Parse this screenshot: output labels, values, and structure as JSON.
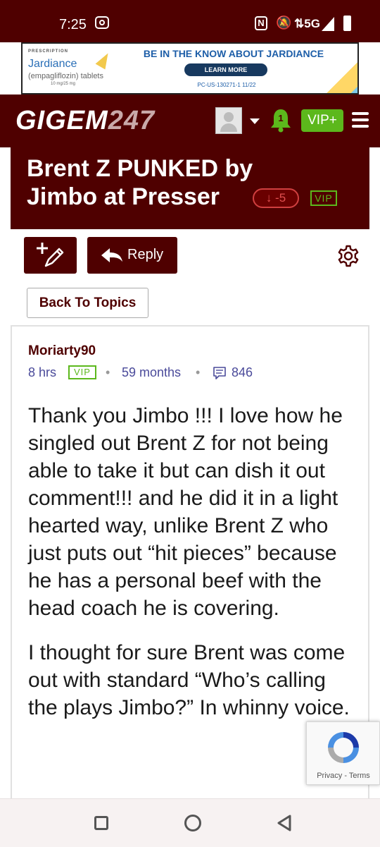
{
  "status_bar": {
    "time": "7:25",
    "network": "5G",
    "nfc": "N"
  },
  "ad": {
    "rx_label": "PRESCRIPTION",
    "brand": "Jardiance",
    "brand_sub": "(empagliflozin) tablets",
    "brand_dose": "10 mg/25 mg",
    "headline": "BE IN THE KNOW ABOUT JARDIANCE",
    "cta": "LEARN MORE",
    "code": "PC-US-130271-1 11/22"
  },
  "header": {
    "logo_text": "GIGEM",
    "logo_num": "247",
    "notification_count": "1",
    "vip_label": "VIP+"
  },
  "topic": {
    "title": "Brent Z PUNKED by Jimbo at Presser",
    "vote_label": "↓ -5",
    "vote_score": -5,
    "vip_badge": "VIP"
  },
  "actions": {
    "reply_label": "Reply",
    "back_label": "Back To Topics"
  },
  "post": {
    "author": "Moriarty90",
    "time_ago": "8 hrs",
    "vip_badge": "VIP",
    "membership": "59 months",
    "post_count": "846",
    "paragraphs": [
      "Thank you Jimbo !!! I love how he singled out Brent Z for not being able to take it but can dish it out comment!!! and he did it in a light hearted way, unlike Brent Z who just puts out “hit pieces” because he has a personal beef with the head coach he is covering.",
      "I thought for sure Brent was come out with standard “Who’s calling the plays Jimbo?” In whinny voice."
    ]
  },
  "recaptcha": {
    "privacy": "Privacy",
    "separator": "-",
    "terms": "Terms"
  },
  "colors": {
    "brand": "#4f0000",
    "vip_green": "#5cb81c",
    "meta_text": "#4a4a9a",
    "vote_red": "#d04040"
  }
}
